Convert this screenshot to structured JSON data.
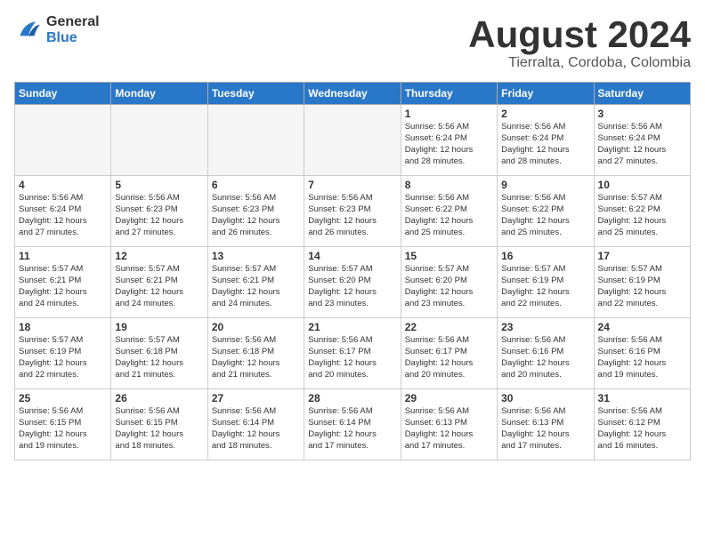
{
  "logo": {
    "line1": "General",
    "line2": "Blue"
  },
  "calendar": {
    "title": "August 2024",
    "subtitle": "Tierralta, Cordoba, Colombia"
  },
  "header_row": [
    "Sunday",
    "Monday",
    "Tuesday",
    "Wednesday",
    "Thursday",
    "Friday",
    "Saturday"
  ],
  "weeks": [
    [
      {
        "day": "",
        "info": ""
      },
      {
        "day": "",
        "info": ""
      },
      {
        "day": "",
        "info": ""
      },
      {
        "day": "",
        "info": ""
      },
      {
        "day": "1",
        "info": "Sunrise: 5:56 AM\nSunset: 6:24 PM\nDaylight: 12 hours\nand 28 minutes."
      },
      {
        "day": "2",
        "info": "Sunrise: 5:56 AM\nSunset: 6:24 PM\nDaylight: 12 hours\nand 28 minutes."
      },
      {
        "day": "3",
        "info": "Sunrise: 5:56 AM\nSunset: 6:24 PM\nDaylight: 12 hours\nand 27 minutes."
      }
    ],
    [
      {
        "day": "4",
        "info": "Sunrise: 5:56 AM\nSunset: 6:24 PM\nDaylight: 12 hours\nand 27 minutes."
      },
      {
        "day": "5",
        "info": "Sunrise: 5:56 AM\nSunset: 6:23 PM\nDaylight: 12 hours\nand 27 minutes."
      },
      {
        "day": "6",
        "info": "Sunrise: 5:56 AM\nSunset: 6:23 PM\nDaylight: 12 hours\nand 26 minutes."
      },
      {
        "day": "7",
        "info": "Sunrise: 5:56 AM\nSunset: 6:23 PM\nDaylight: 12 hours\nand 26 minutes."
      },
      {
        "day": "8",
        "info": "Sunrise: 5:56 AM\nSunset: 6:22 PM\nDaylight: 12 hours\nand 25 minutes."
      },
      {
        "day": "9",
        "info": "Sunrise: 5:56 AM\nSunset: 6:22 PM\nDaylight: 12 hours\nand 25 minutes."
      },
      {
        "day": "10",
        "info": "Sunrise: 5:57 AM\nSunset: 6:22 PM\nDaylight: 12 hours\nand 25 minutes."
      }
    ],
    [
      {
        "day": "11",
        "info": "Sunrise: 5:57 AM\nSunset: 6:21 PM\nDaylight: 12 hours\nand 24 minutes."
      },
      {
        "day": "12",
        "info": "Sunrise: 5:57 AM\nSunset: 6:21 PM\nDaylight: 12 hours\nand 24 minutes."
      },
      {
        "day": "13",
        "info": "Sunrise: 5:57 AM\nSunset: 6:21 PM\nDaylight: 12 hours\nand 24 minutes."
      },
      {
        "day": "14",
        "info": "Sunrise: 5:57 AM\nSunset: 6:20 PM\nDaylight: 12 hours\nand 23 minutes."
      },
      {
        "day": "15",
        "info": "Sunrise: 5:57 AM\nSunset: 6:20 PM\nDaylight: 12 hours\nand 23 minutes."
      },
      {
        "day": "16",
        "info": "Sunrise: 5:57 AM\nSunset: 6:19 PM\nDaylight: 12 hours\nand 22 minutes."
      },
      {
        "day": "17",
        "info": "Sunrise: 5:57 AM\nSunset: 6:19 PM\nDaylight: 12 hours\nand 22 minutes."
      }
    ],
    [
      {
        "day": "18",
        "info": "Sunrise: 5:57 AM\nSunset: 6:19 PM\nDaylight: 12 hours\nand 22 minutes."
      },
      {
        "day": "19",
        "info": "Sunrise: 5:57 AM\nSunset: 6:18 PM\nDaylight: 12 hours\nand 21 minutes."
      },
      {
        "day": "20",
        "info": "Sunrise: 5:56 AM\nSunset: 6:18 PM\nDaylight: 12 hours\nand 21 minutes."
      },
      {
        "day": "21",
        "info": "Sunrise: 5:56 AM\nSunset: 6:17 PM\nDaylight: 12 hours\nand 20 minutes."
      },
      {
        "day": "22",
        "info": "Sunrise: 5:56 AM\nSunset: 6:17 PM\nDaylight: 12 hours\nand 20 minutes."
      },
      {
        "day": "23",
        "info": "Sunrise: 5:56 AM\nSunset: 6:16 PM\nDaylight: 12 hours\nand 20 minutes."
      },
      {
        "day": "24",
        "info": "Sunrise: 5:56 AM\nSunset: 6:16 PM\nDaylight: 12 hours\nand 19 minutes."
      }
    ],
    [
      {
        "day": "25",
        "info": "Sunrise: 5:56 AM\nSunset: 6:15 PM\nDaylight: 12 hours\nand 19 minutes."
      },
      {
        "day": "26",
        "info": "Sunrise: 5:56 AM\nSunset: 6:15 PM\nDaylight: 12 hours\nand 18 minutes."
      },
      {
        "day": "27",
        "info": "Sunrise: 5:56 AM\nSunset: 6:14 PM\nDaylight: 12 hours\nand 18 minutes."
      },
      {
        "day": "28",
        "info": "Sunrise: 5:56 AM\nSunset: 6:14 PM\nDaylight: 12 hours\nand 17 minutes."
      },
      {
        "day": "29",
        "info": "Sunrise: 5:56 AM\nSunset: 6:13 PM\nDaylight: 12 hours\nand 17 minutes."
      },
      {
        "day": "30",
        "info": "Sunrise: 5:56 AM\nSunset: 6:13 PM\nDaylight: 12 hours\nand 17 minutes."
      },
      {
        "day": "31",
        "info": "Sunrise: 5:56 AM\nSunset: 6:12 PM\nDaylight: 12 hours\nand 16 minutes."
      }
    ]
  ]
}
